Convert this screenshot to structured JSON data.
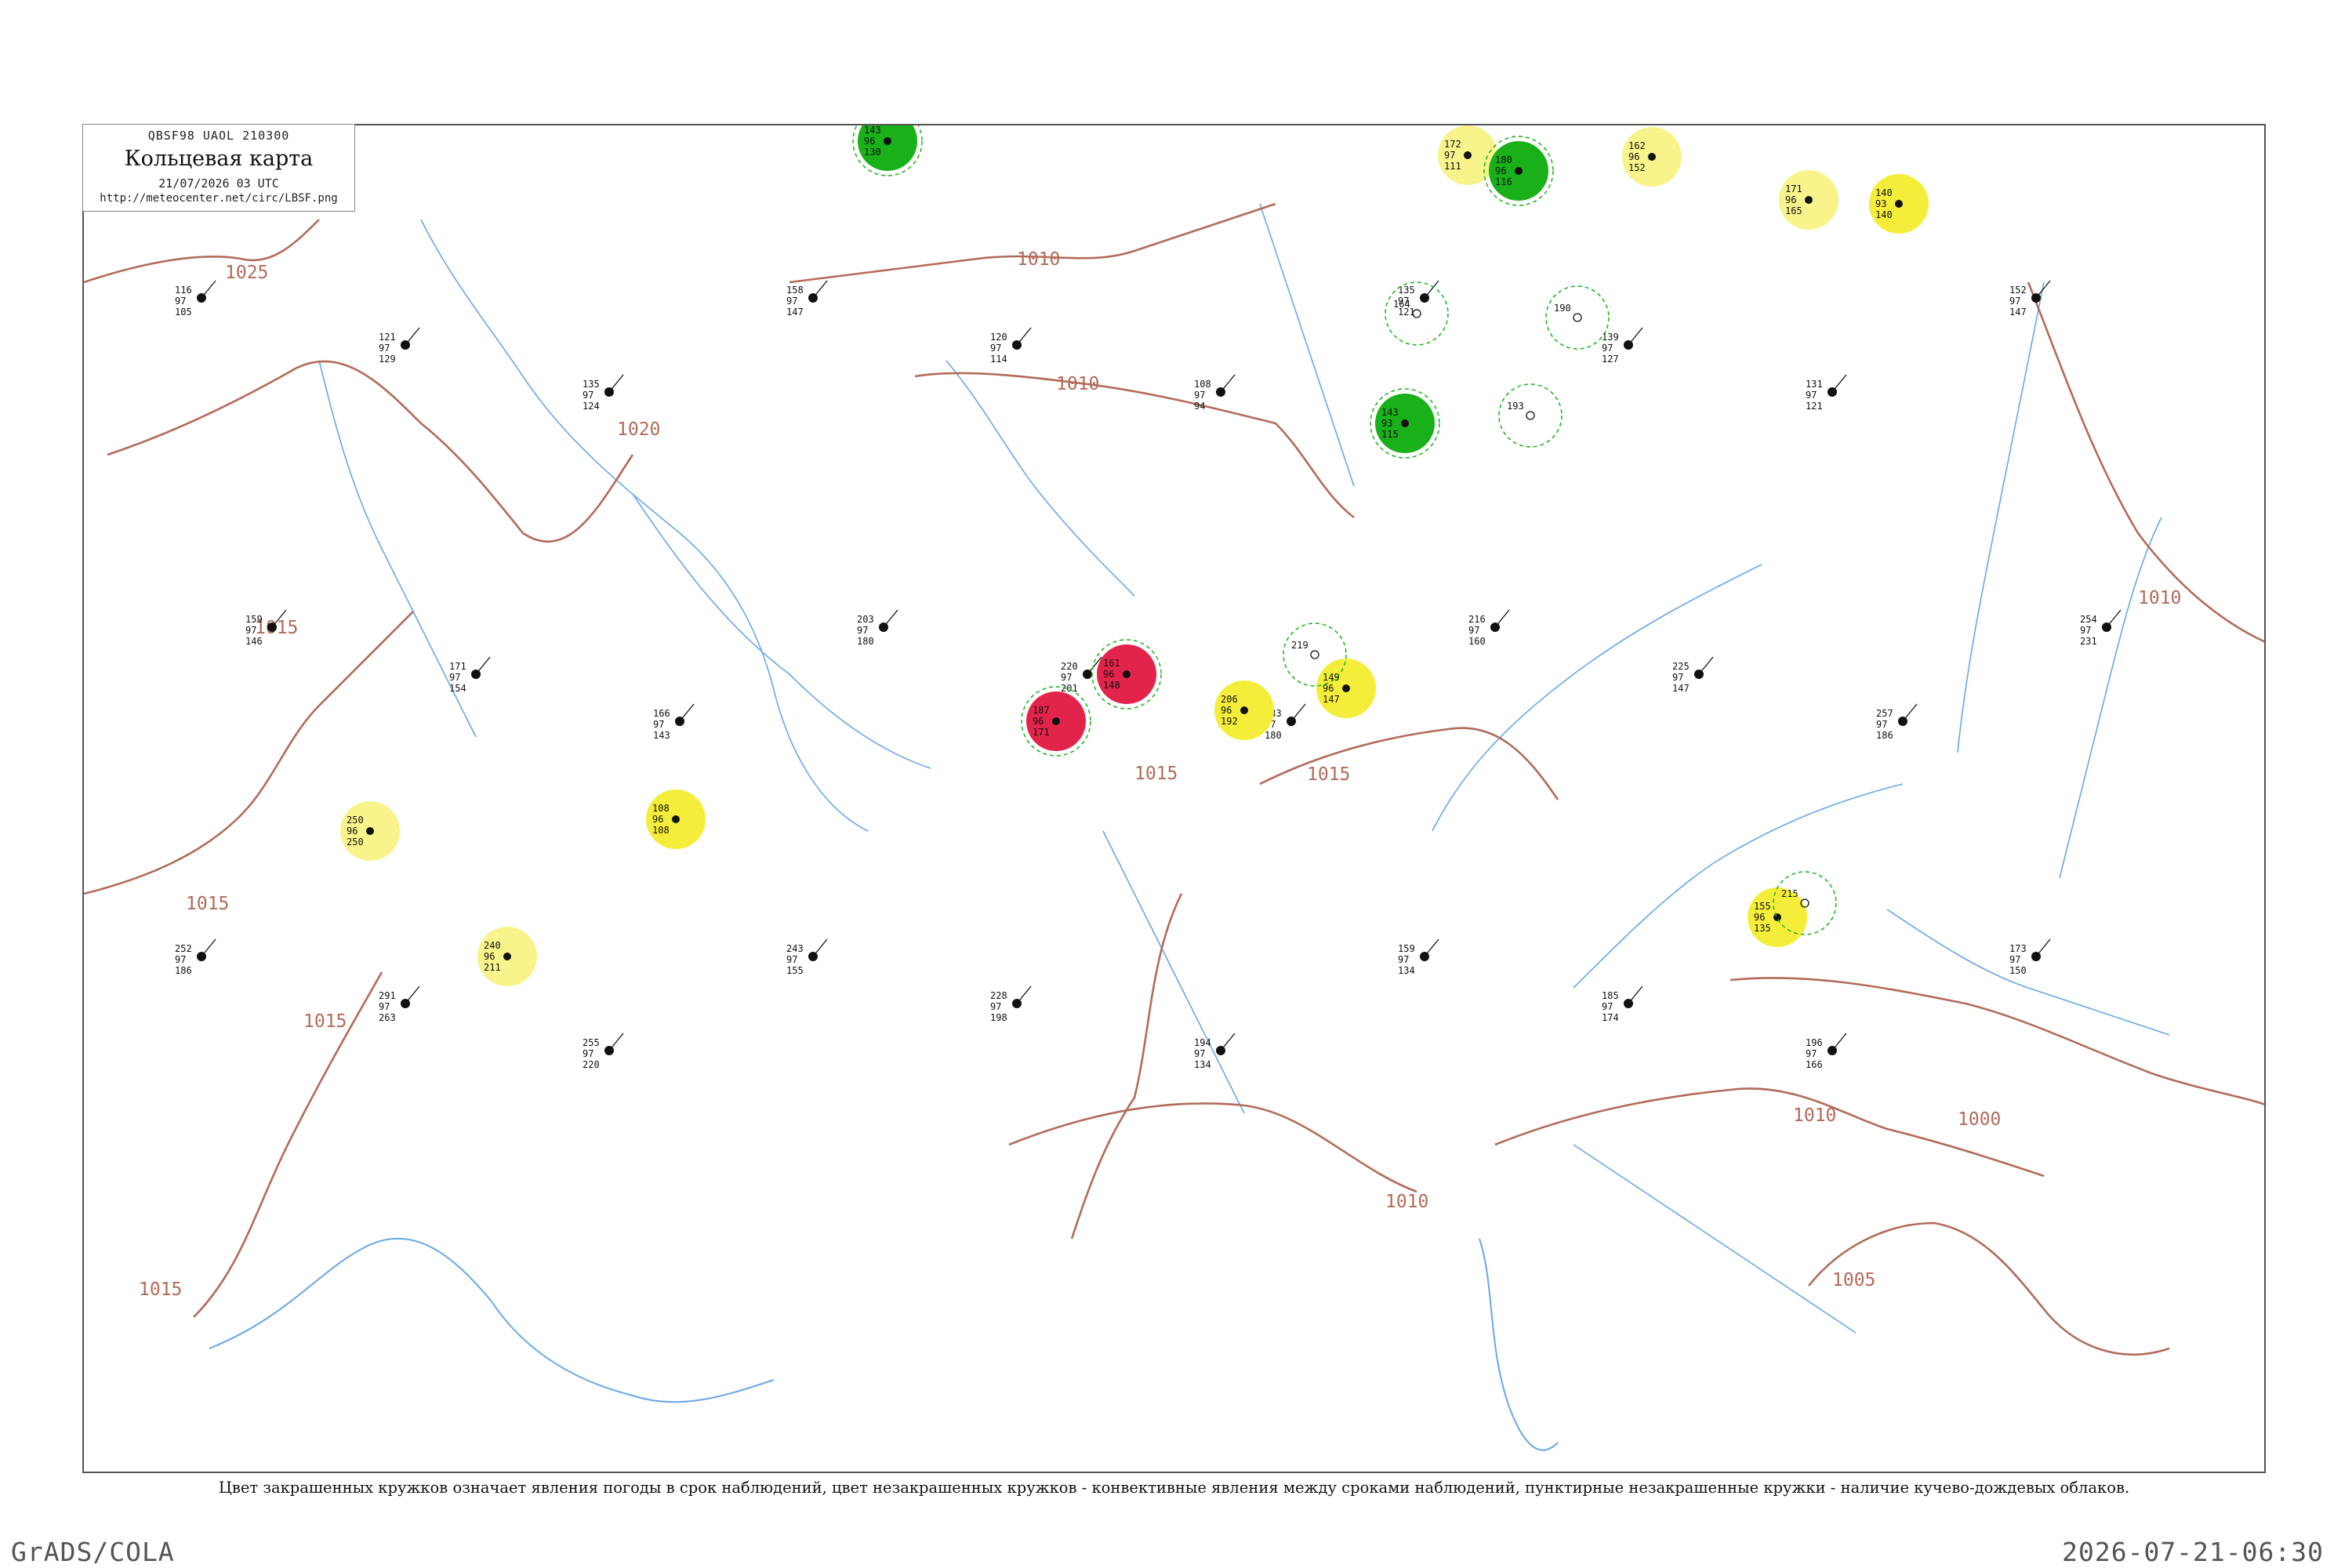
{
  "header": {
    "code": "QBSF98  UAOL  210300",
    "title": "Кольцевая карта",
    "date": "21/07/2026 03 UTC",
    "url": "http://meteocenter.net/circ/LBSF.png"
  },
  "legend_note": "Цвет закрашенных кружков означает явления погоды в срок наблюдений, цвет незакрашенных кружков - конвективные явления между сроками наблюдений, пунктирные незакрашенные кружки - наличие кучево-дождевых облаков.",
  "footer": {
    "software": "GrADS/COLA",
    "timestamp": "2026-07-21-06:30"
  },
  "colors": {
    "isobar": "#b26b5a",
    "water": "#6aa7e6",
    "thunderstorm": "#1ab01a",
    "fog_haze": "#f4ee3a",
    "haze_light": "#f8f38a",
    "dust": "#f0a030",
    "heavy_precip": "#e3244a",
    "cb_dashed": "#1ab01a"
  },
  "isobar_labels": [
    {
      "text": "1025"
    },
    {
      "text": "1020"
    },
    {
      "text": "1015"
    },
    {
      "text": "1015"
    },
    {
      "text": "1015"
    },
    {
      "text": "1015"
    },
    {
      "text": "1015"
    },
    {
      "text": "1010"
    },
    {
      "text": "1010"
    },
    {
      "text": "1010"
    },
    {
      "text": "1010"
    },
    {
      "text": "1010"
    },
    {
      "text": "1005"
    },
    {
      "text": "1000"
    },
    {
      "text": "1015"
    }
  ],
  "stations": [
    {
      "temp": "172",
      "dew": "97",
      "press": "111",
      "color": "#f8f38a",
      "cb": false
    },
    {
      "temp": "180",
      "dew": "96",
      "press": "116",
      "color": "#1ab01a",
      "cb": true
    },
    {
      "temp": "162",
      "dew": "96",
      "press": "152",
      "color": "#f8f38a",
      "cb": false
    },
    {
      "temp": "171",
      "dew": "96",
      "press": "165",
      "color": "#f8f38a",
      "cb": false
    },
    {
      "temp": "140",
      "dew": "93",
      "press": "140",
      "color": "#f4ee3a",
      "cb": false
    },
    {
      "temp": "161",
      "dew": "96",
      "press": "148",
      "color": "#e3244a",
      "cb": true
    },
    {
      "temp": "108",
      "dew": "96",
      "press": "108",
      "color": "#f4ee3a",
      "cb": false
    },
    {
      "temp": "155",
      "dew": "96",
      "press": "135",
      "color": "#f4ee3a",
      "cb": false
    },
    {
      "temp": "250",
      "dew": "96",
      "press": "250",
      "color": "#f8f38a",
      "cb": false
    },
    {
      "temp": "240",
      "dew": "96",
      "press": "211",
      "color": "#f8f38a",
      "cb": false
    },
    {
      "temp": "143",
      "dew": "96",
      "press": "130",
      "color": "#1ab01a",
      "cb": true
    },
    {
      "temp": "187",
      "dew": "96",
      "press": "171",
      "color": "#e3244a",
      "cb": true
    },
    {
      "temp": "206",
      "dew": "96",
      "press": "192",
      "color": "#f4ee3a",
      "cb": false
    },
    {
      "temp": "149",
      "dew": "96",
      "press": "147",
      "color": "#f4ee3a",
      "cb": false
    },
    {
      "temp": "143",
      "dew": "93",
      "press": "115",
      "color": "#1ab01a",
      "cb": true
    }
  ],
  "plain_stations": [
    {
      "temp": "116",
      "dew": "97",
      "press": "105"
    },
    {
      "temp": "121",
      "dew": "97",
      "press": "129"
    },
    {
      "temp": "135",
      "dew": "97",
      "press": "124"
    },
    {
      "temp": "158",
      "dew": "97",
      "press": "147"
    },
    {
      "temp": "120",
      "dew": "97",
      "press": "114"
    },
    {
      "temp": "108",
      "dew": "97",
      "press": "94"
    },
    {
      "temp": "135",
      "dew": "97",
      "press": "121"
    },
    {
      "temp": "139",
      "dew": "97",
      "press": "127"
    },
    {
      "temp": "131",
      "dew": "97",
      "press": "121"
    },
    {
      "temp": "152",
      "dew": "97",
      "press": "147"
    },
    {
      "temp": "159",
      "dew": "97",
      "press": "146"
    },
    {
      "temp": "171",
      "dew": "97",
      "press": "154"
    },
    {
      "temp": "166",
      "dew": "97",
      "press": "143"
    },
    {
      "temp": "203",
      "dew": "97",
      "press": "180"
    },
    {
      "temp": "220",
      "dew": "97",
      "press": "201"
    },
    {
      "temp": "233",
      "dew": "97",
      "press": "180"
    },
    {
      "temp": "216",
      "dew": "97",
      "press": "160"
    },
    {
      "temp": "225",
      "dew": "97",
      "press": "147"
    },
    {
      "temp": "257",
      "dew": "97",
      "press": "186"
    },
    {
      "temp": "254",
      "dew": "97",
      "press": "231"
    },
    {
      "temp": "252",
      "dew": "97",
      "press": "186"
    },
    {
      "temp": "291",
      "dew": "97",
      "press": "263"
    },
    {
      "temp": "255",
      "dew": "97",
      "press": "220"
    },
    {
      "temp": "243",
      "dew": "97",
      "press": "155"
    },
    {
      "temp": "228",
      "dew": "97",
      "press": "198"
    },
    {
      "temp": "194",
      "dew": "97",
      "press": "134"
    },
    {
      "temp": "159",
      "dew": "97",
      "press": "134"
    },
    {
      "temp": "185",
      "dew": "97",
      "press": "174"
    },
    {
      "temp": "196",
      "dew": "97",
      "press": "166"
    },
    {
      "temp": "173",
      "dew": "97",
      "press": "150"
    }
  ],
  "cb_only_circles": [
    {
      "temp": "164"
    },
    {
      "temp": "193"
    },
    {
      "temp": "219"
    },
    {
      "temp": "190"
    },
    {
      "temp": "215"
    }
  ]
}
